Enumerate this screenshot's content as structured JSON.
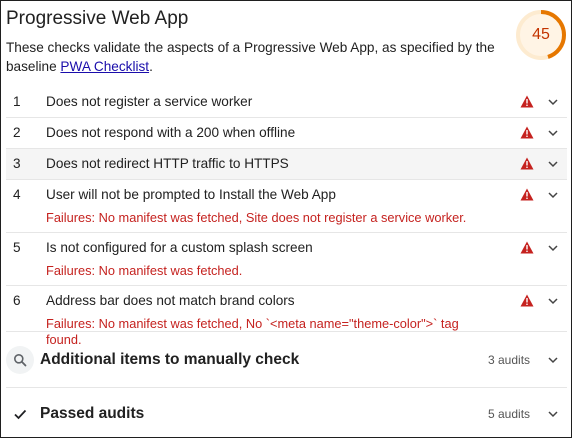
{
  "header": {
    "title": "Progressive Web App",
    "description_prefix": "These checks validate the aspects of a Progressive Web App, as specified by the baseline ",
    "link_text": "PWA Checklist",
    "description_suffix": ".",
    "score": "45",
    "score_fraction": 0.45,
    "score_color": "#e67700"
  },
  "audits": [
    {
      "num": "1",
      "title": "Does not register a service worker",
      "failure": ""
    },
    {
      "num": "2",
      "title": "Does not respond with a 200 when offline",
      "failure": ""
    },
    {
      "num": "3",
      "title": "Does not redirect HTTP traffic to HTTPS",
      "failure": ""
    },
    {
      "num": "4",
      "title": "User will not be prompted to Install the Web App",
      "failure": "Failures: No manifest was fetched, Site does not register a service worker."
    },
    {
      "num": "5",
      "title": "Is not configured for a custom splash screen",
      "failure": "Failures: No manifest was fetched."
    },
    {
      "num": "6",
      "title": "Address bar does not match brand colors",
      "failure": "Failures: No manifest was fetched, No `<meta name=\"theme-color\">` tag found."
    }
  ],
  "groups": {
    "manual": {
      "title": "Additional items to manually check",
      "count": "3 audits",
      "icon": "search-icon"
    },
    "passed": {
      "title": "Passed audits",
      "count": "5 audits",
      "icon": "checkmark-icon"
    }
  },
  "colors": {
    "fail_icon": "#c5221f",
    "failure_text": "#c5221f",
    "link": "#1a0dab"
  }
}
